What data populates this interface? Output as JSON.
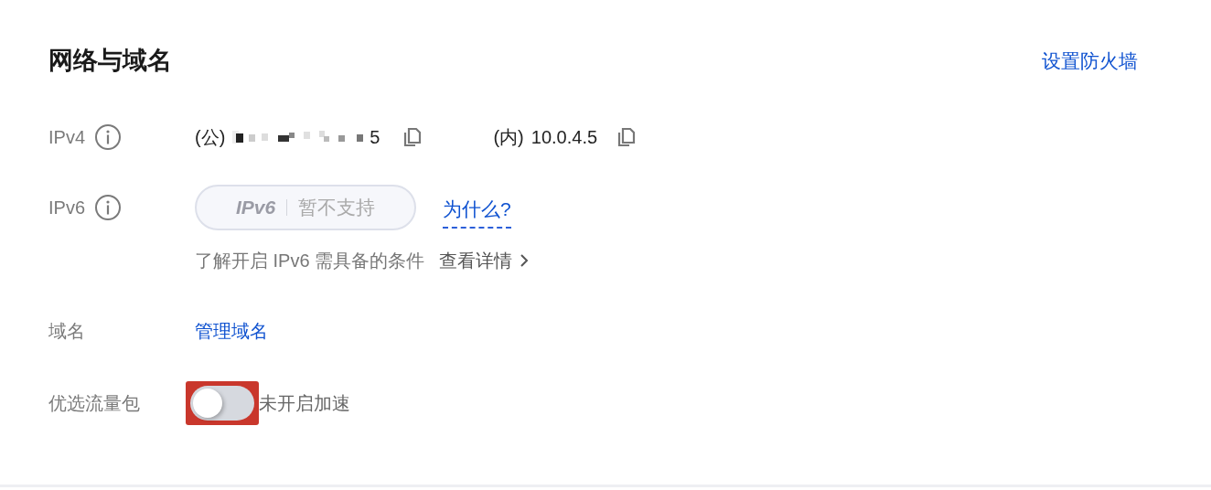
{
  "section": {
    "title": "网络与域名",
    "action_link": "设置防火墙"
  },
  "ipv4": {
    "label": "IPv4",
    "public_prefix": "(公)",
    "public_suffix": "5",
    "private_prefix": "(内)",
    "private_address": "10.0.4.5"
  },
  "ipv6": {
    "label": "IPv6",
    "badge_name": "IPv6",
    "badge_status": "暂不支持",
    "why_link": "为什么?",
    "hint": "了解开启 IPv6 需具备的条件",
    "details_link": "查看详情"
  },
  "domain": {
    "label": "域名",
    "manage_link": "管理域名"
  },
  "traffic_package": {
    "label": "优选流量包",
    "on": false,
    "highlighted": true,
    "status": "未开启加速"
  }
}
